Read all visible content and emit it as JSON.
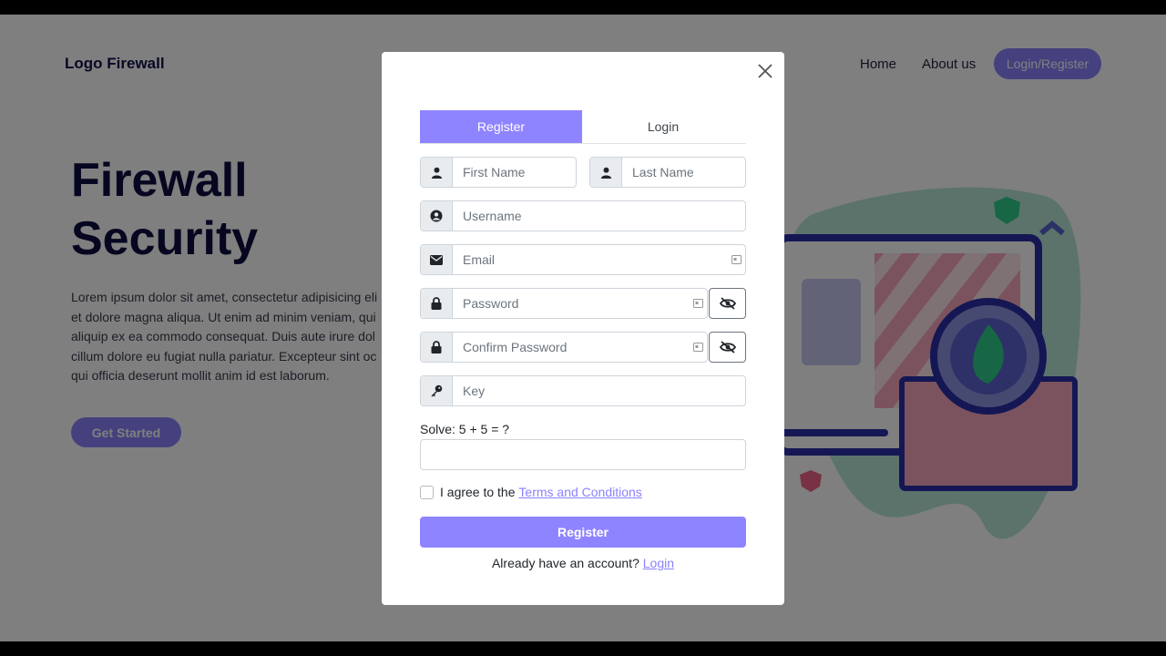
{
  "nav": {
    "logo": "Logo Firewall",
    "home": "Home",
    "about": "About us",
    "login_register": "Login/Register"
  },
  "hero": {
    "title_line1": "Firewall",
    "title_line2": "Security",
    "text_lines": [
      "Lorem ipsum dolor sit amet, consectetur adipisicing eli",
      "et dolore magna aliqua. Ut enim ad minim veniam, qui",
      "aliquip ex ea commodo consequat. Duis aute irure dol",
      "cillum dolore eu fugiat nulla pariatur. Excepteur sint oc",
      "qui officia deserunt mollit anim id est laborum."
    ],
    "cta": "Get Started"
  },
  "modal": {
    "tabs": {
      "register": "Register",
      "login": "Login"
    },
    "fields": {
      "first_name": "First Name",
      "last_name": "Last Name",
      "username": "Username",
      "email": "Email",
      "password": "Password",
      "confirm_password": "Confirm Password",
      "key": "Key"
    },
    "solve_label": "Solve: 5 + 5 = ?",
    "agree_prefix": "I agree to the ",
    "terms_link": "Terms and Conditions",
    "submit": "Register",
    "already_text": "Already have an account? ",
    "login_link": "Login"
  },
  "colors": {
    "accent": "#8f84ff",
    "heading": "#0d0d40"
  },
  "icons": [
    "close-icon",
    "user-icon",
    "user-circle-icon",
    "envelope-icon",
    "lock-icon",
    "eye-slash-icon",
    "key-icon",
    "id-card-icon"
  ]
}
